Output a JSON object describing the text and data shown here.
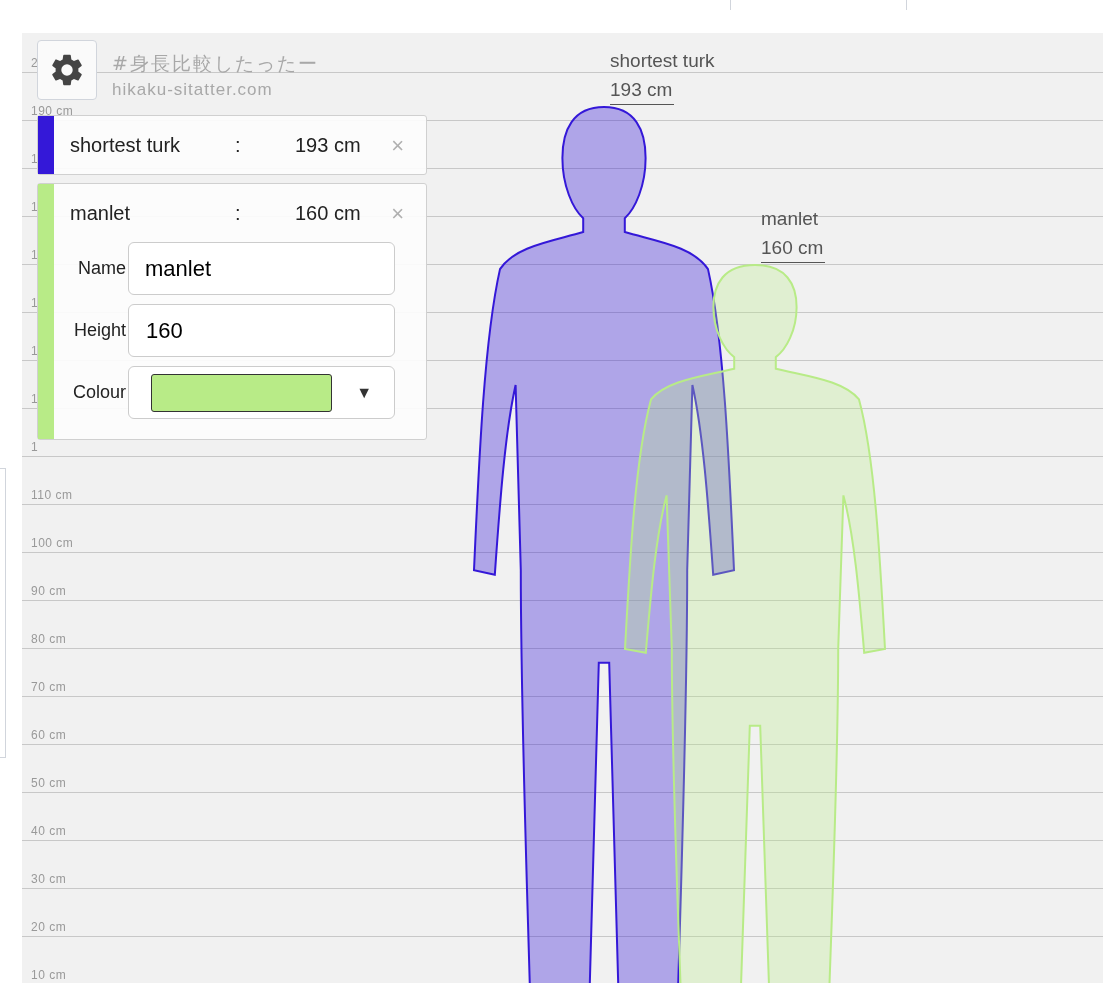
{
  "header": {
    "site_title": "#身長比較したったー",
    "site_url": "hikaku-sitatter.com"
  },
  "scale": {
    "ticks": [
      {
        "label": "2"
      },
      {
        "label": "190 cm"
      },
      {
        "label": "1"
      },
      {
        "label": "1"
      },
      {
        "label": "1"
      },
      {
        "label": "1"
      },
      {
        "label": "1"
      },
      {
        "label": "1"
      },
      {
        "label": "1"
      },
      {
        "label": "110 cm"
      },
      {
        "label": "100 cm"
      },
      {
        "label": "90 cm"
      },
      {
        "label": "80 cm"
      },
      {
        "label": "70 cm"
      },
      {
        "label": "60 cm"
      },
      {
        "label": "50 cm"
      },
      {
        "label": "40 cm"
      },
      {
        "label": "30 cm"
      },
      {
        "label": "20 cm"
      },
      {
        "label": "10 cm"
      }
    ]
  },
  "people": [
    {
      "name": "shortest turk",
      "separator": ":",
      "height": "193 cm",
      "color": "#3418d8",
      "close": "×",
      "expanded": false
    },
    {
      "name": "manlet",
      "separator": ":",
      "height": "160 cm",
      "color": "#b8eb87",
      "close": "×",
      "expanded": true,
      "form": {
        "name_label": "Name",
        "name_value": "manlet",
        "height_label": "Height",
        "height_value": "160",
        "colour_label": "Colour",
        "dropdown": "▼"
      }
    }
  ],
  "figures": [
    {
      "name": "shortest turk",
      "height": "193 cm"
    },
    {
      "name": "manlet",
      "height": "160 cm"
    }
  ]
}
